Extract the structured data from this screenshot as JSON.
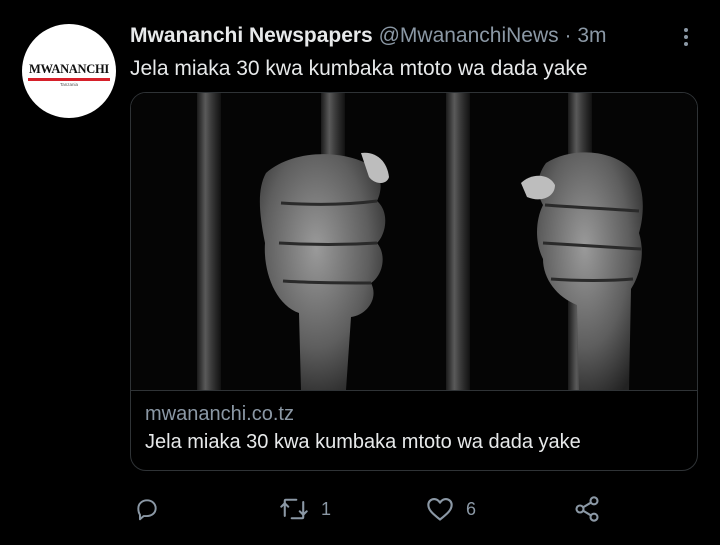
{
  "tweet": {
    "author": {
      "name": "Mwananchi Newspapers",
      "handle": "@MwananchiNews",
      "separator": " · ",
      "time": "3m",
      "avatar_brand": "MWANANCHI",
      "avatar_tagline": "Tanzania"
    },
    "text": "Jela miaka 30 kwa kumbaka mtoto wa dada yake",
    "card": {
      "domain": "mwananchi.co.tz",
      "title": "Jela miaka 30 kwa kumbaka mtoto wa dada yake",
      "image_icon": "prison-bars-hands-image"
    },
    "actions": {
      "reply_count": "",
      "retweet_count": "1",
      "like_count": "6"
    }
  },
  "icons": {
    "more": "more-vertical-icon",
    "reply": "reply-icon",
    "retweet": "retweet-icon",
    "like": "heart-icon",
    "share": "share-icon"
  },
  "colors": {
    "background": "#000000",
    "text": "#e7e9ea",
    "secondary": "#8b98a5",
    "border": "#2f3336",
    "brand_red": "#d6202a"
  }
}
